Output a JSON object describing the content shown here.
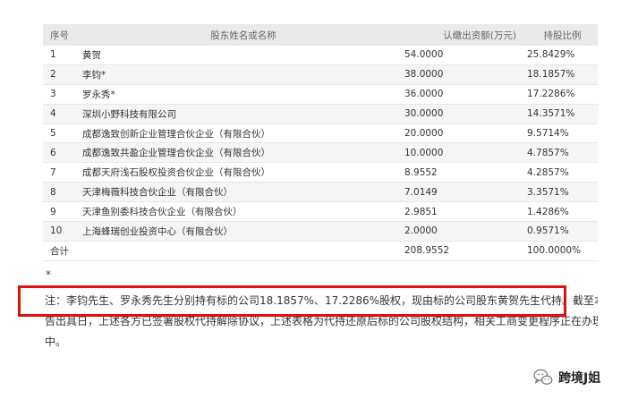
{
  "table": {
    "headers": {
      "no": "序号",
      "name": "股东姓名或名称",
      "capital": "认缴出资额(万元)",
      "ratio": "持股比例"
    },
    "rows": [
      {
        "no": "1",
        "name": "黄贺",
        "capital": "54.0000",
        "ratio": "25.8429%"
      },
      {
        "no": "2",
        "name": "李钧*",
        "capital": "38.0000",
        "ratio": "18.1857%"
      },
      {
        "no": "3",
        "name": "罗永秀*",
        "capital": "36.0000",
        "ratio": "17.2286%"
      },
      {
        "no": "4",
        "name": "深圳小野科技有限公司",
        "capital": "30.0000",
        "ratio": "14.3571%"
      },
      {
        "no": "5",
        "name": "成都逸致创新企业管理合伙企业（有限合伙）",
        "capital": "20.0000",
        "ratio": "9.5714%"
      },
      {
        "no": "6",
        "name": "成都逸致共盈企业管理合伙企业（有限合伙）",
        "capital": "10.0000",
        "ratio": "4.7857%"
      },
      {
        "no": "7",
        "name": "成都天府浅石股权投资合伙企业（有限合伙）",
        "capital": "8.9552",
        "ratio": "4.2857%"
      },
      {
        "no": "8",
        "name": "天津梅薇科技合伙企业（有限合伙）",
        "capital": "7.0149",
        "ratio": "3.3571%"
      },
      {
        "no": "9",
        "name": "天津鱼别委科技合伙企业（有限合伙）",
        "capital": "2.9851",
        "ratio": "1.4286%"
      },
      {
        "no": "10",
        "name": "上海蜂瑞创业投资中心（有限合伙）",
        "capital": "2.0000",
        "ratio": "0.9571%"
      },
      {
        "no": "合计",
        "name": "",
        "capital": "208.9552",
        "ratio": "100.0000%"
      }
    ]
  },
  "footnote_marker": "*",
  "note": {
    "line1": "注：李钧先生、罗永秀先生分别持有标的公司18.1857%、17.2286%股权，现由标的公司股东黄贺先生代持。截至本公",
    "line2": "告出具日，上述各方已签署股权代持解除协议，上述表格为代持还原后标的公司股权结构，相关工商变更程序正在办理",
    "line3": "中。"
  },
  "watermark": {
    "text": "跨境J姐",
    "icon": "wechat-icon"
  },
  "colors": {
    "highlight_border": "#e01010",
    "header_bg": "#e9e9e9",
    "stripe_bg": "#f5f5f5"
  }
}
